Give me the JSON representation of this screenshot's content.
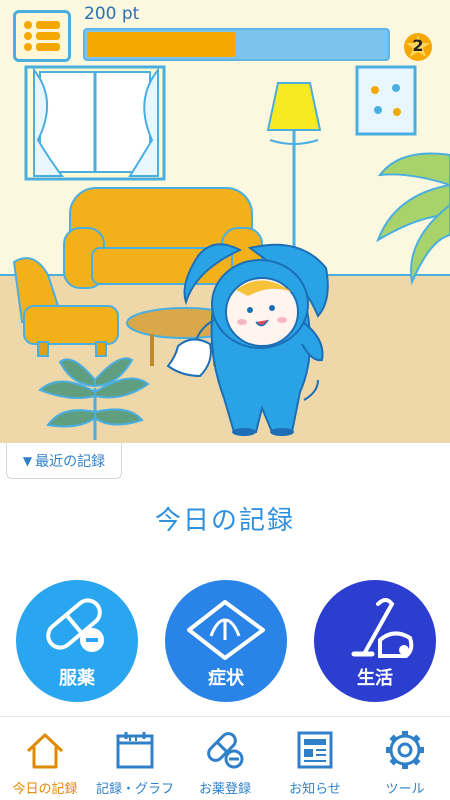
{
  "header": {
    "points_label": "200 pt",
    "points_progress": 0.5,
    "level": "2"
  },
  "recent": {
    "label": "最近の記録",
    "arrow": "▼"
  },
  "title": "今日の記録",
  "actions": [
    {
      "label": "服薬",
      "icon": "pill-icon",
      "color": "#2aa6f0"
    },
    {
      "label": "症状",
      "icon": "tissue-icon",
      "color": "#2a84e8"
    },
    {
      "label": "生活",
      "icon": "vacuum-icon",
      "color": "#2c3ed0"
    }
  ],
  "nav": [
    {
      "label": "今日の記録",
      "icon": "home-icon",
      "active": true
    },
    {
      "label": "記録・グラフ",
      "icon": "calendar-icon",
      "active": false
    },
    {
      "label": "お薬登録",
      "icon": "pill-icon",
      "active": false
    },
    {
      "label": "お知らせ",
      "icon": "newspaper-icon",
      "active": false
    },
    {
      "label": "ツール",
      "icon": "gear-icon",
      "active": false
    }
  ],
  "colors": {
    "accent": "#2f90dd",
    "active_nav": "#e08a00",
    "progress_fill": "#f5a800",
    "progress_track": "#7cc4ec"
  }
}
